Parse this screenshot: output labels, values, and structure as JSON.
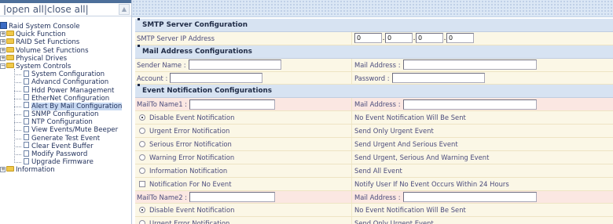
{
  "nav": {
    "open_all": "open all",
    "close_all": "close all",
    "separator": "|",
    "root_label": "Raid System Console",
    "items": [
      {
        "label": "Quick Function",
        "type": "folder"
      },
      {
        "label": "RAID Set Functions",
        "type": "folder"
      },
      {
        "label": "Volume Set Functions",
        "type": "folder"
      },
      {
        "label": "Physical Drives",
        "type": "folder"
      },
      {
        "label": "System Controls",
        "type": "folder-open"
      }
    ],
    "children": [
      "System Configuration",
      "Advancd Configuration",
      "Hdd Power Management",
      "EtherNet Configuration",
      "Alert By Mail Configuration",
      "SNMP Configuration",
      "NTP Configuration",
      "View Events/Mute Beeper",
      "Generate Test Event",
      "Clear Event Buffer",
      "Modify Password",
      "Upgrade Firmware"
    ],
    "selected": "Alert By Mail Configuration",
    "last": "Information"
  },
  "smtp": {
    "header": "SMTP Server Configuration",
    "ip_label": "SMTP Server IP Address",
    "ip": [
      "0",
      "0",
      "0",
      "0"
    ]
  },
  "mail": {
    "header": "Mail Address Configurations",
    "sender_label": "Sender Name :",
    "sender_value": "",
    "mail_label": "Mail Address :",
    "mail_value": "",
    "account_label": "Account :",
    "account_value": "",
    "password_label": "Password :",
    "password_value": ""
  },
  "events": {
    "header": "Event Notification Configurations",
    "mailto1_label": "MailTo Name1 :",
    "mailto1_value": "",
    "mail1_label": "Mail Address :",
    "mail1_value": "",
    "mailto2_label": "MailTo Name2 :",
    "mailto2_value": "",
    "mail2_label": "Mail Address :",
    "mail2_value": "",
    "options1": [
      {
        "label": "Disable Event Notification",
        "desc": "No Event Notification Will Be Sent",
        "checked": true
      },
      {
        "label": "Urgent Error Notification",
        "desc": "Send Only Urgent Event",
        "checked": false
      },
      {
        "label": "Serious Error Notification",
        "desc": "Send Urgent And Serious Event",
        "checked": false
      },
      {
        "label": "Warning Error Notification",
        "desc": "Send Urgent, Serious And Warning Event",
        "checked": false
      },
      {
        "label": "Information Notification",
        "desc": "Send All Event",
        "checked": false
      }
    ],
    "no_event_label": "Notification For No Event",
    "no_event_desc": "Notify User If No Event Occurs Within 24 Hours",
    "no_event_checked": false,
    "options2": [
      {
        "label": "Disable Event Notification",
        "desc": "No Event Notification Will Be Sent",
        "checked": true
      },
      {
        "label": "Urgent Error Notification",
        "desc": "Send Only Urgent Event",
        "checked": false
      }
    ]
  },
  "colors": {
    "section_header": "#d7e3f2",
    "row_bg": "#fbf7e6",
    "mailto_row_bg": "#fbe7e2",
    "banner": "#dbe7f5"
  }
}
